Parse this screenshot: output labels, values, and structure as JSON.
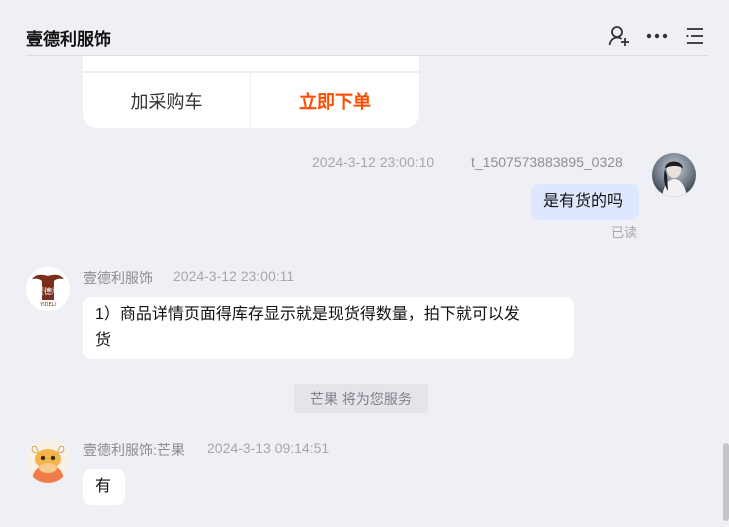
{
  "header": {
    "title": "壹德利服饰",
    "icons": [
      "person-add-icon",
      "more-icon",
      "menu-list-icon"
    ]
  },
  "order_card": {
    "add_to_cart_label": "加采购车",
    "buy_now_label": "立即下单",
    "buy_now_color": "#ff4d00"
  },
  "messages": [
    {
      "sender": "t_1507573883895_0328",
      "time": "2024-3-12 23:00:10",
      "text": "是有货的吗",
      "status": "已读"
    },
    {
      "sender": "壹德利服饰",
      "time": "2024-3-12 23:00:11",
      "text_line1": "1）商品详情页面得库存显示就是现货得数量，拍下就可以发",
      "text_line2": "货",
      "avatar_text": "壹德利",
      "avatar_sub": "YIDELI"
    },
    {
      "sender": "壹德利服饰:芒果",
      "time": "2024-3-13 09:14:51",
      "text": "有"
    }
  ],
  "system_notice": "芒果 将为您服务",
  "colors": {
    "background": "#eff0f5",
    "self_bubble": "#dde8ff",
    "accent": "#ff4d00"
  }
}
